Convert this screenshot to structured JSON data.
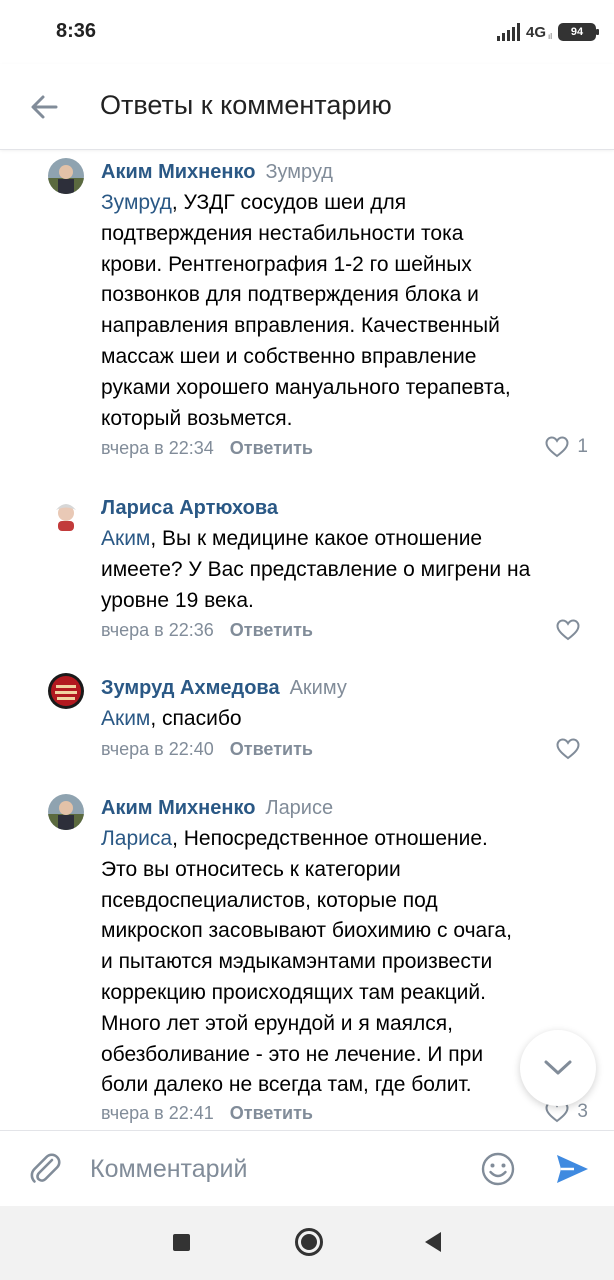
{
  "status_bar": {
    "time": "8:36",
    "network": "4G",
    "battery": "94"
  },
  "header": {
    "title": "Ответы к комментарию"
  },
  "comments": [
    {
      "author": "Аким Михненко",
      "reply_to": "Зумруд",
      "mention": "Зумруд",
      "text_lines": [
        ", УЗДГ сосудов шеи для",
        "подтверждения нестабильности тока",
        "крови. Рентгенография 1-2 го шейных",
        "позвонков для подтверждения блока и",
        "направления вправления. Качественный",
        "массаж шеи и собственно вправление",
        "руками хорошего мануального терапевта,",
        "который возьмется."
      ],
      "time": "вчера в 22:34",
      "reply_label": "Ответить",
      "likes": "1"
    },
    {
      "author": "Лариса Артюхова",
      "reply_to": "",
      "mention": "Аким",
      "text_lines": [
        ", Вы к медицине какое отношение",
        "имеете? У Вас представление о мигрени на",
        "уровне 19 века."
      ],
      "time": "вчера в 22:36",
      "reply_label": "Ответить",
      "likes": ""
    },
    {
      "author": "Зумруд Ахмедова",
      "reply_to": "Акиму",
      "mention": "Аким",
      "text_lines": [
        ", спасибо"
      ],
      "time": "вчера в 22:40",
      "reply_label": "Ответить",
      "likes": ""
    },
    {
      "author": "Аким Михненко",
      "reply_to": "Ларисе",
      "mention": "Лариса",
      "text_lines": [
        ", Непосредственное отношение.",
        "Это вы относитесь к категории",
        "псевдоспециалистов, которые под",
        "микроскоп засовывают биохимию с очага,",
        "и пытаются мэдыкамэнтами произвести",
        "коррекцию происходящих там реакций.",
        "Много лет этой ерундой и я маялся,",
        "обезболивание - это не лечение. И при",
        "боли далеко не всегда там, где болит."
      ],
      "time": "вчера в 22:41",
      "reply_label": "Ответить",
      "likes": "3"
    }
  ],
  "composer": {
    "placeholder": "Комментарий"
  },
  "colors": {
    "link": "#2a5885",
    "secondary": "#818c99",
    "send": "#3f8ae0"
  },
  "icons": [
    "back-arrow-icon",
    "heart-icon",
    "chevron-down-icon",
    "paperclip-icon",
    "smile-icon",
    "send-icon",
    "nav-recents-icon",
    "nav-home-icon",
    "nav-back-icon"
  ]
}
